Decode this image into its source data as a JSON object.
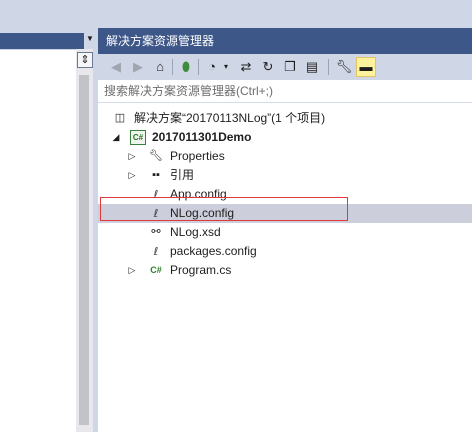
{
  "explorer": {
    "title": "解决方案资源管理器",
    "search_placeholder": "搜索解决方案资源管理器(Ctrl+;)"
  },
  "toolbar": {
    "buttons": [
      "back-icon",
      "forward-icon",
      "home-icon",
      "pending-changes-icon",
      "history-icon",
      "sync-icon",
      "refresh-icon",
      "collapse-all-icon",
      "show-all-files-icon",
      "properties-icon",
      "preview-icon"
    ]
  },
  "tree": {
    "solution": "解决方案“20170113NLog”(1 个项目)",
    "project": "2017011301Demo",
    "items": [
      {
        "label": "Properties",
        "icon": "wrench-icon",
        "expandable": true
      },
      {
        "label": "引用",
        "icon": "references-icon",
        "expandable": true
      },
      {
        "label": "App.config",
        "icon": "config-file-icon",
        "expandable": false
      },
      {
        "label": "NLog.config",
        "icon": "config-file-icon",
        "expandable": false,
        "selected": true
      },
      {
        "label": "NLog.xsd",
        "icon": "xsd-file-icon",
        "expandable": false
      },
      {
        "label": "packages.config",
        "icon": "config-file-icon",
        "expandable": false
      },
      {
        "label": "Program.cs",
        "icon": "csharp-file-icon",
        "expandable": true
      }
    ]
  },
  "colors": {
    "title_bar": "#3e5789",
    "toolbar": "#cfd6e5",
    "selection": "#cccedb",
    "highlight_border": "#e0383b"
  }
}
